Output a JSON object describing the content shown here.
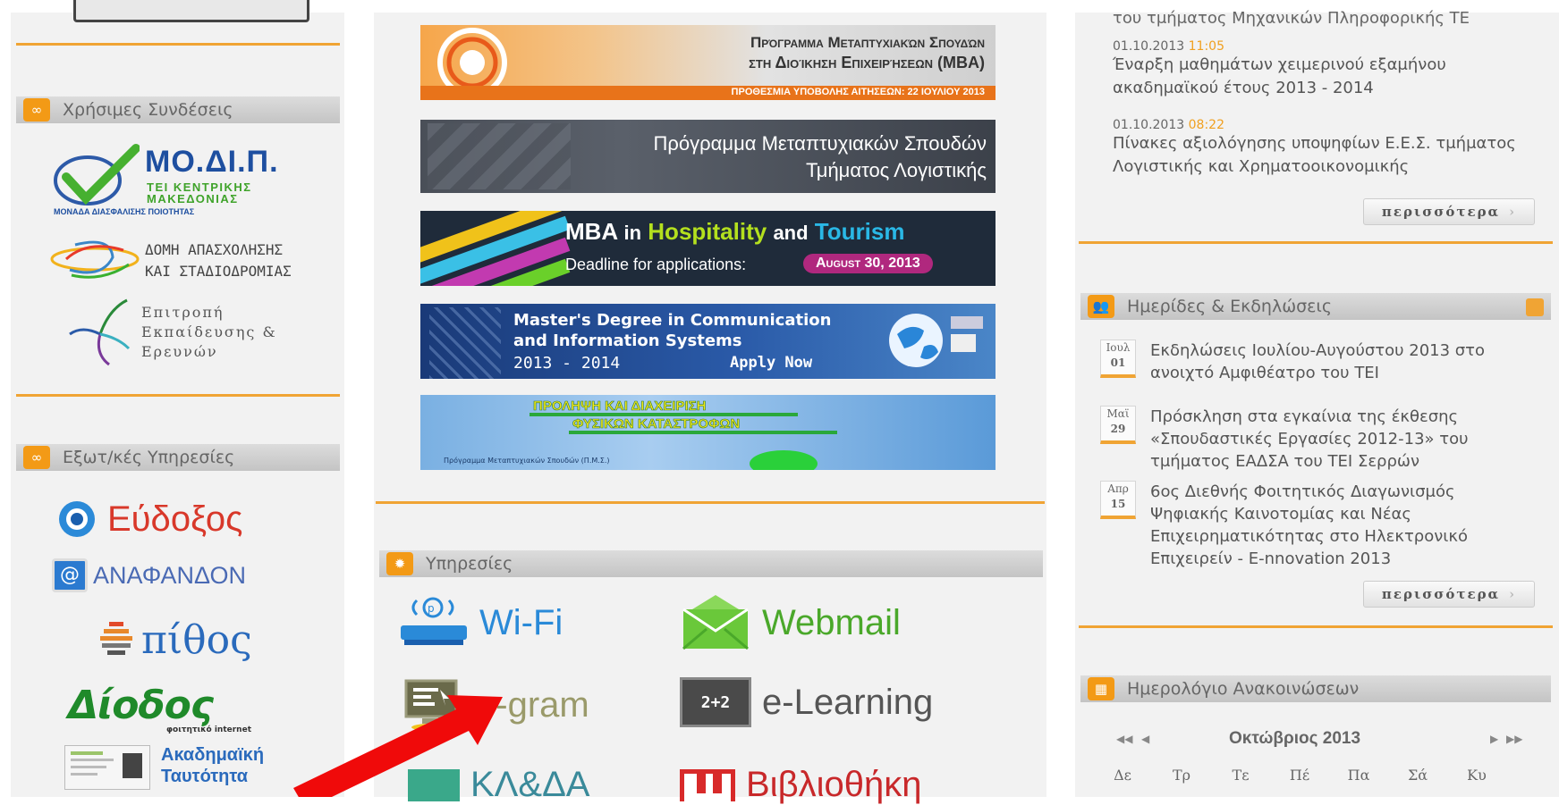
{
  "left": {
    "useful_links_title": "Χρήσιμες Συνδέσεις",
    "external_services_title": "Εξωτ/κές Υπηρεσίες",
    "modip": {
      "title": "ΜΟ.ΔΙ.Π.",
      "line1": "ΤΕΙ ΚΕΝΤΡΙΚΗΣ",
      "line2": "ΜΑΚΕΔΟΝΙΑΣ",
      "line3": "ΜΟΝΑΔΑ ΔΙΑΣΦΑΛΙΣΗΣ ΠΟΙΟΤΗΤΑΣ"
    },
    "domi": {
      "line1": "ΔΟΜΗ ΑΠΑΣΧΟΛΗΣΗΣ",
      "line2": "ΚΑΙ ΣΤΑΔΙΟΔΡΟΜΙΑΣ"
    },
    "committee": {
      "line1": "Επιτροπή",
      "line2": "Εκπαίδευσης &",
      "line3": "Ερευνών"
    },
    "eudoxus": "Εύδοξος",
    "anadanon": "ΑΝΑΦΑΝΔΟΝ",
    "pithos": "πίθος",
    "diodos": "Δίοδος",
    "diodos_sub": "φοιτητικό internet",
    "academic_id": {
      "line1": "Ακαδημαϊκή",
      "line2": "Ταυτότητα"
    }
  },
  "banners": {
    "mba_title1": "Πρόγραμμα Μεταπτυχιακών Σπουδών",
    "mba_title2": "στη Διοίκηση Επιχειρήσεων (MBA)",
    "mba_deadline": "ΠΡΟΘΕΣΜΙΑ ΥΠΟΒΟΛΗΣ ΑΙΤΗΣΕΩΝ: 22 ΙΟΥΛΙΟΥ 2013",
    "accounting1": "Πρόγραμμα Μεταπτυχιακών Σπουδών",
    "accounting2": "Τμήματος Λογιστικής",
    "tourism_mba": "MBA",
    "tourism_in": "in",
    "tourism_hosp": "Hospitality",
    "tourism_and": "and",
    "tourism_tour": "Tourism",
    "tourism_deadline_label": "Deadline for applications:",
    "tourism_deadline_date": "August 30, 2013",
    "comm1": "Master's Degree in Communication",
    "comm2": "and Information Systems",
    "comm_years": "2013 - 2014",
    "comm_apply": "Apply Now",
    "disaster1": "ΠΡΟΛΗΨΗ ΚΑΙ ΔΙΑΧΕΙΡΙΣΗ",
    "disaster2": "ΦΥΣΙΚΩΝ ΚΑΤΑΣΤΡΟΦΩΝ",
    "disaster_footer": "Πρόγραμμα Μεταπτυχιακών Σπουδών (Π.Μ.Σ.)"
  },
  "services": {
    "title": "Υπηρεσίες",
    "wifi": "Wi-Fi",
    "webmail": "Webmail",
    "egram": "e-gram",
    "elearning": "e-Learning",
    "elearning_icon": "2+2",
    "klada": "ΚΛ&ΔΑ",
    "library": "Βιβλιοθήκη"
  },
  "news": {
    "partial": "του τμήματος Μηχανικών Πληροφορικής ΤΕ",
    "items": [
      {
        "date": "01.10.2013",
        "time": "11:05",
        "text": "Έναρξη μαθημάτων χειμερινού εξαμήνου ακαδημαϊκού έτους 2013 - 2014"
      },
      {
        "date": "01.10.2013",
        "time": "08:22",
        "text": "Πίνακες αξιολόγησης υποψηφίων Ε.Ε.Σ. τμήματος Λογιστικής και Χρηματοοικονομικής"
      }
    ],
    "more": "περισσότερα"
  },
  "events": {
    "title": "Ημερίδες & Εκδηλώσεις",
    "items": [
      {
        "month": "Ιουλ",
        "day": "01",
        "text": "Εκδηλώσεις Ιουλίου-Αυγούστου 2013 στο ανοιχτό Αμφιθέατρο του ΤΕΙ"
      },
      {
        "month": "Μαϊ",
        "day": "29",
        "text": "Πρόσκληση στα εγκαίνια της έκθεσης «Σπουδαστικές Εργασίες 2012-13» του τμήματος ΕΑΔΣΑ του ΤΕΙ Σερρών"
      },
      {
        "month": "Απρ",
        "day": "15",
        "text": "6ος Διεθνής Φοιτητικός Διαγωνισμός Ψηφιακής Καινοτομίας και Νέας Επιχειρηματικότητας στο Ηλεκτρονικό Επιχειρείν - E-nnovation 2013"
      }
    ],
    "more": "περισσότερα"
  },
  "calendar": {
    "title": "Ημερολόγιο Ανακοινώσεων",
    "month": "Οκτώβριος 2013",
    "nav_prev_year": "◀◀",
    "nav_prev": "◀",
    "nav_next": "▶",
    "nav_next_year": "▶▶",
    "days": [
      "Δε",
      "Τρ",
      "Τε",
      "Πέ",
      "Πα",
      "Σά",
      "Κυ"
    ]
  }
}
